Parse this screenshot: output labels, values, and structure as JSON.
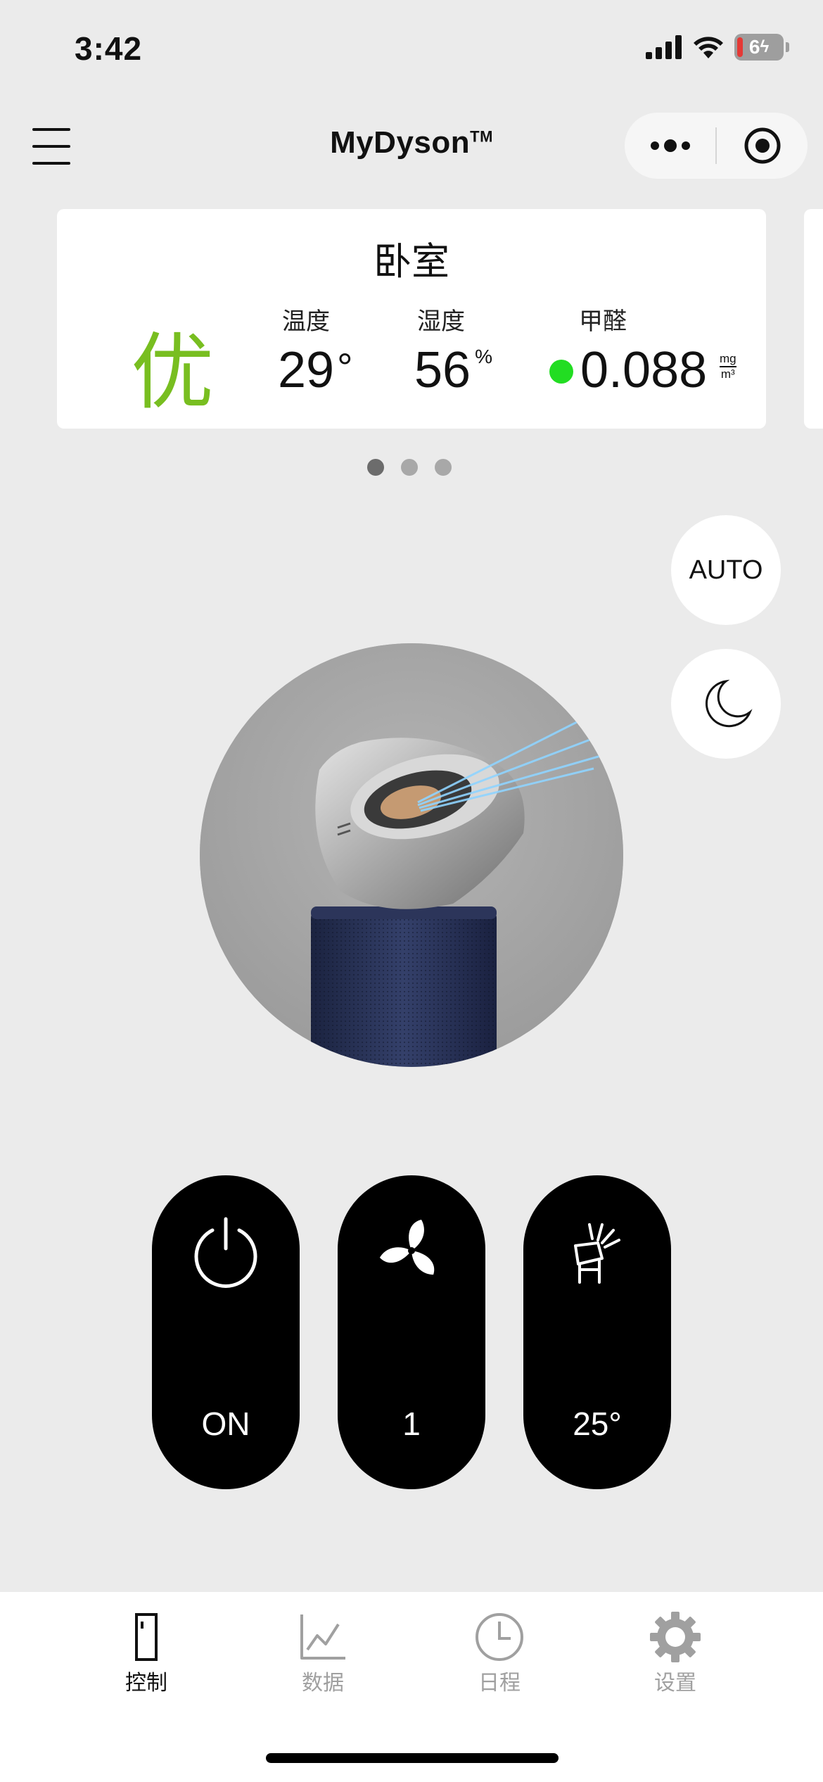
{
  "status_bar": {
    "time": "3:42",
    "battery": "6"
  },
  "header": {
    "title": "MyDyson",
    "title_mark": "TM"
  },
  "room_card": {
    "room_name": "卧室",
    "air_quality": "优",
    "temperature": {
      "label": "温度",
      "value": "29",
      "unit": "°"
    },
    "humidity": {
      "label": "湿度",
      "value": "56",
      "unit": "%"
    },
    "formaldehyde": {
      "label": "甲醛",
      "value": "0.088",
      "unit_top": "mg",
      "unit_bottom": "m³",
      "status_color": "#22dd22"
    }
  },
  "pager": {
    "count": 3,
    "active_index": 0
  },
  "modes": {
    "auto_label": "AUTO",
    "night_icon": "moon-icon"
  },
  "controls": {
    "power": {
      "icon": "power-icon",
      "label": "ON"
    },
    "fan_speed": {
      "icon": "fan-icon",
      "label": "1"
    },
    "oscillation": {
      "icon": "tilt-lamp-icon",
      "label": "25°"
    }
  },
  "tabs": [
    {
      "icon": "device-icon",
      "label": "控制",
      "active": true
    },
    {
      "icon": "chart-icon",
      "label": "数据",
      "active": false
    },
    {
      "icon": "clock-icon",
      "label": "日程",
      "active": false
    },
    {
      "icon": "gear-icon",
      "label": "设置",
      "active": false
    }
  ],
  "colors": {
    "background": "#ebebeb",
    "quality_good": "#78be20",
    "pill": "#000000",
    "tab_inactive": "#a0a0a0"
  }
}
